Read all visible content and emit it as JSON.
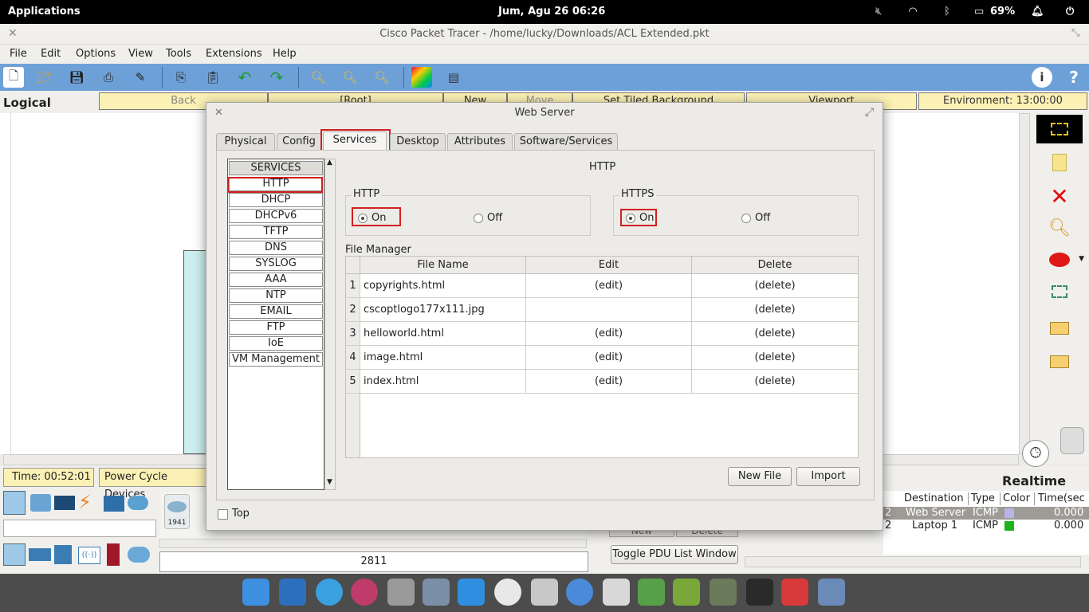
{
  "topbar": {
    "applications": "Applications",
    "datetime": "Jum, Agu 26   06:26",
    "battery": "69%"
  },
  "window": {
    "title": "Cisco Packet Tracer - /home/lucky/Downloads/ACL Extended.pkt"
  },
  "menu": [
    "File",
    "Edit",
    "Options",
    "View",
    "Tools",
    "Extensions",
    "Help"
  ],
  "logicalbar": {
    "logical": "Logical",
    "back": "Back",
    "root": "[Root]",
    "new_cluster": "New Cluster",
    "move_object": "Move Object",
    "set_bg": "Set Tiled Background",
    "viewport": "Viewport",
    "environment": "Environment: 13:00:00"
  },
  "bottom": {
    "time": "Time: 00:52:01",
    "power_cycle": "Power Cycle Devices",
    "device_model": "2811",
    "device_1941": "1941",
    "realtime": "Realtime",
    "toggle_pdu": "Toggle PDU List Window",
    "new_btn": "New",
    "delete_btn": "Delete",
    "pdu_headers": [
      "Destination",
      "Type",
      "Color",
      "Time(sec"
    ],
    "pdu_rows": [
      {
        "num": "2",
        "dest": "Web Server",
        "type": "ICMP",
        "color": "#b9b4e6",
        "time": "0.000"
      },
      {
        "num": "2",
        "dest": "Laptop 1",
        "type": "ICMP",
        "color": "#1cb31c",
        "time": "0.000"
      }
    ]
  },
  "dialog": {
    "title": "Web Server",
    "tabs": [
      "Physical",
      "Config",
      "Services",
      "Desktop",
      "Attributes",
      "Software/Services"
    ],
    "active_tab": "Services",
    "services_header": "SERVICES",
    "services": [
      "HTTP",
      "DHCP",
      "DHCPv6",
      "TFTP",
      "DNS",
      "SYSLOG",
      "AAA",
      "NTP",
      "EMAIL",
      "FTP",
      "IoE",
      "VM Management"
    ],
    "selected_service": "HTTP",
    "panel_title": "HTTP",
    "http": {
      "label": "HTTP",
      "on": "On",
      "off": "Off",
      "state": "On"
    },
    "https": {
      "label": "HTTPS",
      "on": "On",
      "off": "Off",
      "state": "On"
    },
    "file_manager": {
      "label": "File Manager",
      "headers": [
        "File Name",
        "Edit",
        "Delete"
      ],
      "rows": [
        {
          "n": "1",
          "name": "copyrights.html",
          "edit": "(edit)",
          "del": "(delete)"
        },
        {
          "n": "2",
          "name": "cscoptlogo177x111.jpg",
          "edit": "",
          "del": "(delete)"
        },
        {
          "n": "3",
          "name": "helloworld.html",
          "edit": "(edit)",
          "del": "(delete)"
        },
        {
          "n": "4",
          "name": "image.html",
          "edit": "(edit)",
          "del": "(delete)"
        },
        {
          "n": "5",
          "name": "index.html",
          "edit": "(edit)",
          "del": "(delete)"
        }
      ]
    },
    "new_file": "New File",
    "import": "Import",
    "top_checkbox": "Top"
  }
}
